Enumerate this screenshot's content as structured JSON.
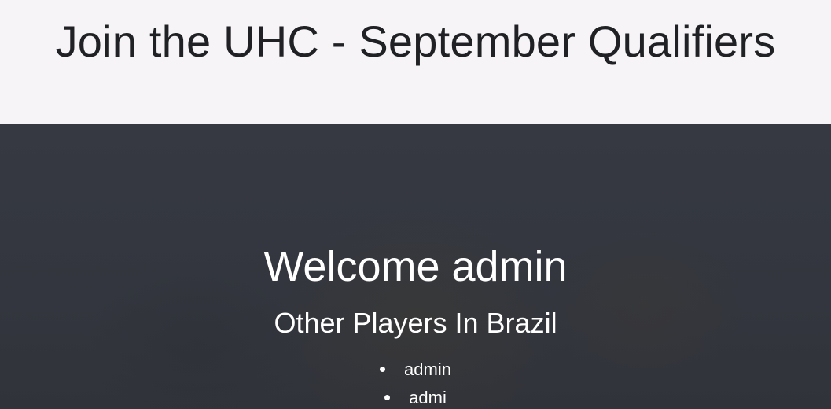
{
  "header": {
    "title": "Join the UHC - September Qualifiers"
  },
  "hero": {
    "welcome": "Welcome admin",
    "subtitle": "Other Players In Brazil",
    "players": [
      "admin",
      "admi"
    ]
  }
}
